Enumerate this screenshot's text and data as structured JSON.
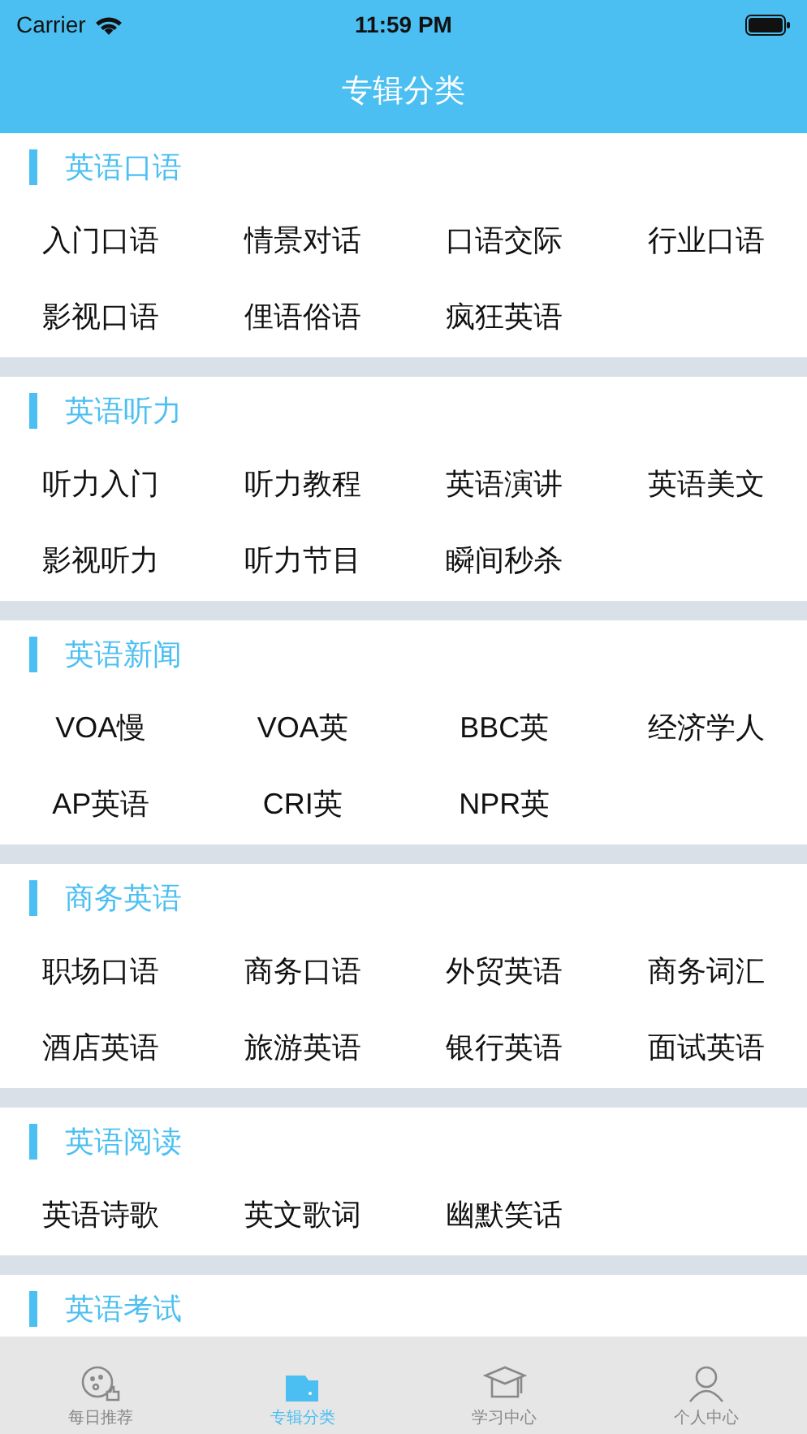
{
  "status_bar": {
    "carrier": "Carrier",
    "time": "11:59 PM"
  },
  "nav": {
    "title": "专辑分类"
  },
  "sections": [
    {
      "title": "英语口语",
      "items": [
        "入门口语",
        "情景对话",
        "口语交际",
        "行业口语",
        "影视口语",
        "俚语俗语",
        "疯狂英语"
      ]
    },
    {
      "title": "英语听力",
      "items": [
        "听力入门",
        "听力教程",
        "英语演讲",
        "英语美文",
        "影视听力",
        "听力节目",
        "瞬间秒杀"
      ]
    },
    {
      "title": "英语新闻",
      "items": [
        "VOA慢",
        "VOA英",
        "BBC英",
        "经济学人",
        "AP英语",
        "CRI英",
        "NPR英"
      ]
    },
    {
      "title": "商务英语",
      "items": [
        "职场口语",
        "商务口语",
        "外贸英语",
        "商务词汇",
        "酒店英语",
        "旅游英语",
        "银行英语",
        "面试英语"
      ]
    },
    {
      "title": "英语阅读",
      "items": [
        "英语诗歌",
        "英文歌词",
        "幽默笑话"
      ]
    },
    {
      "title": "英语考试"
    }
  ],
  "tabs": [
    {
      "kind": "smile",
      "label": "每日推荐",
      "selected": false
    },
    {
      "kind": "folder",
      "label": "专辑分类",
      "selected": true
    },
    {
      "kind": "cap",
      "label": "学习中心",
      "selected": false
    },
    {
      "kind": "person",
      "label": "个人中心",
      "selected": false
    }
  ]
}
